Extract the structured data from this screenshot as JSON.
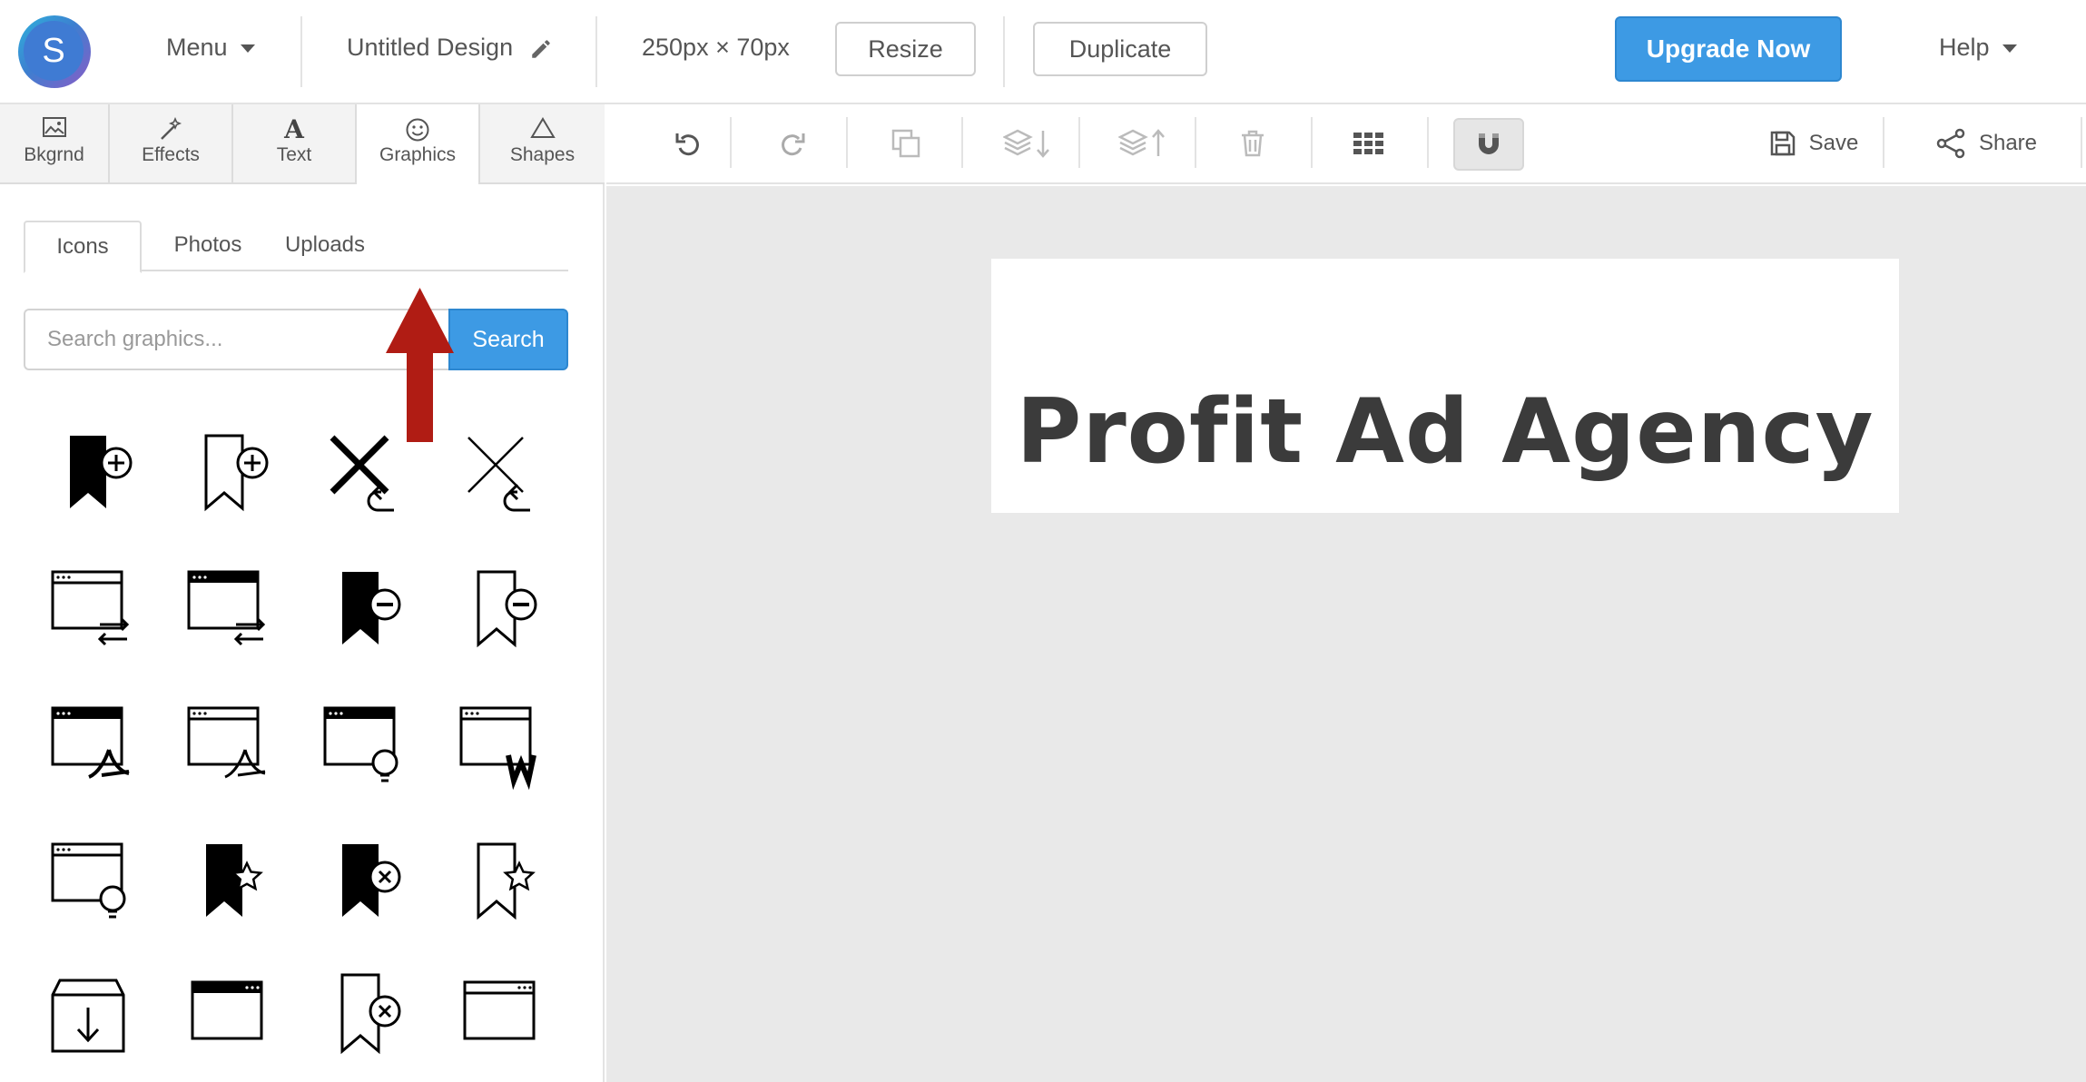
{
  "app": {
    "logo_letter": "S"
  },
  "topbar": {
    "menu_label": "Menu",
    "design_title": "Untitled Design",
    "dimensions": "250px × 70px",
    "resize_label": "Resize",
    "duplicate_label": "Duplicate",
    "upgrade_label": "Upgrade Now",
    "help_label": "Help"
  },
  "panel_tabs": [
    {
      "label": "Bkgrnd",
      "icon": "image-icon"
    },
    {
      "label": "Effects",
      "icon": "magic-wand-icon"
    },
    {
      "label": "Text",
      "icon": "text-icon"
    },
    {
      "label": "Graphics",
      "icon": "smiley-icon"
    },
    {
      "label": "Shapes",
      "icon": "triangle-icon"
    }
  ],
  "graphics": {
    "subtabs": [
      "Icons",
      "Photos",
      "Uploads"
    ],
    "active_subtab": "Icons",
    "search_placeholder": "Search graphics...",
    "search_button": "Search",
    "icons": [
      "bookmark-add-filled-icon",
      "bookmark-add-outline-icon",
      "close-undo-bold-icon",
      "close-undo-thin-icon",
      "window-transfer-icon",
      "window-transfer-filled-icon",
      "bookmark-remove-filled-icon",
      "bookmark-remove-outline-icon",
      "window-pdf-icon",
      "window-pdf-outline-icon",
      "window-lightbulb-icon",
      "window-word-icon",
      "window-lightbulb-outline-icon",
      "bookmark-star-filled-icon",
      "bookmark-close-filled-icon",
      "bookmark-star-outline-icon",
      "inbox-download-icon",
      "browser-window-icon",
      "bookmark-close-outline-icon",
      "browser-window-outline-icon"
    ]
  },
  "toolbar": {
    "save_label": "Save",
    "share_label": "Share",
    "tools": [
      "undo-icon",
      "redo-icon",
      "copy-icon",
      "send-backward-icon",
      "bring-forward-icon",
      "trash-icon",
      "grid-icon",
      "magnet-icon"
    ]
  },
  "canvas": {
    "design_text": "Profit Ad Agency"
  },
  "annotation": {
    "color": "#b01c14"
  },
  "colors": {
    "accent": "#3d9ae4"
  }
}
